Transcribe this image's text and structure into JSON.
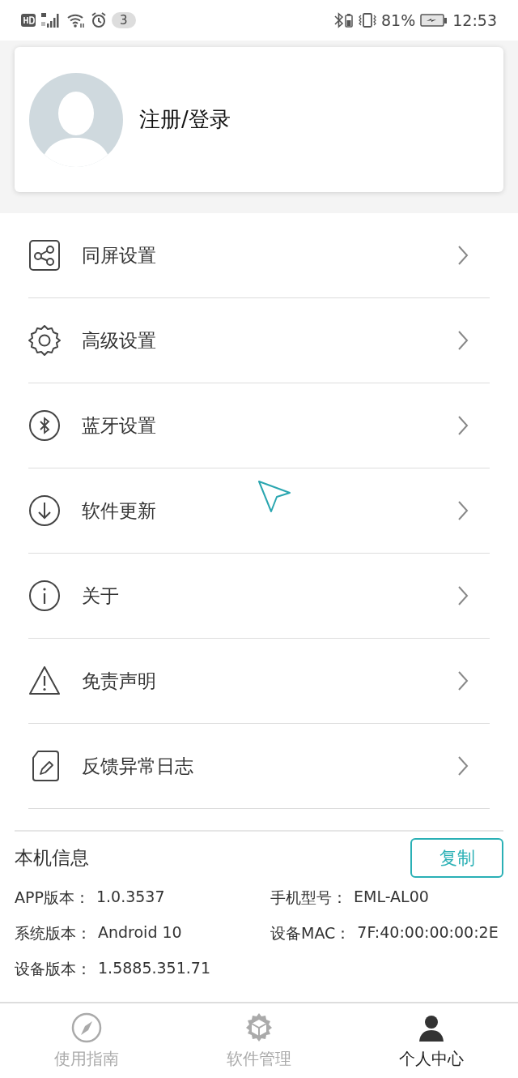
{
  "status_bar": {
    "notification_count": "3",
    "battery_percent": "81%",
    "time": "12:53"
  },
  "profile": {
    "label": "注册/登录"
  },
  "menu": [
    {
      "kind": "share",
      "label": "同屏设置"
    },
    {
      "kind": "gear",
      "label": "高级设置"
    },
    {
      "kind": "bluetooth",
      "label": "蓝牙设置"
    },
    {
      "kind": "download",
      "label": "软件更新"
    },
    {
      "kind": "info",
      "label": "关于"
    },
    {
      "kind": "warning",
      "label": "免责声明"
    },
    {
      "kind": "edit",
      "label": "反馈异常日志"
    }
  ],
  "device_info": {
    "title": "本机信息",
    "copy_button": "复制",
    "fields": [
      {
        "label": "APP版本：",
        "value": "1.0.3537"
      },
      {
        "label": "手机型号：",
        "value": "EML-AL00"
      },
      {
        "label": "系统版本：",
        "value": "Android 10"
      },
      {
        "label": "设备MAC：",
        "value": "7F:40:00:00:00:2E"
      },
      {
        "label": "设备版本：",
        "value": "1.5885.351.71"
      }
    ]
  },
  "bottom_nav": [
    {
      "kind": "compass",
      "label": "使用指南",
      "selected": false
    },
    {
      "kind": "cube",
      "label": "软件管理",
      "selected": false
    },
    {
      "kind": "person",
      "label": "个人中心",
      "selected": true
    }
  ]
}
